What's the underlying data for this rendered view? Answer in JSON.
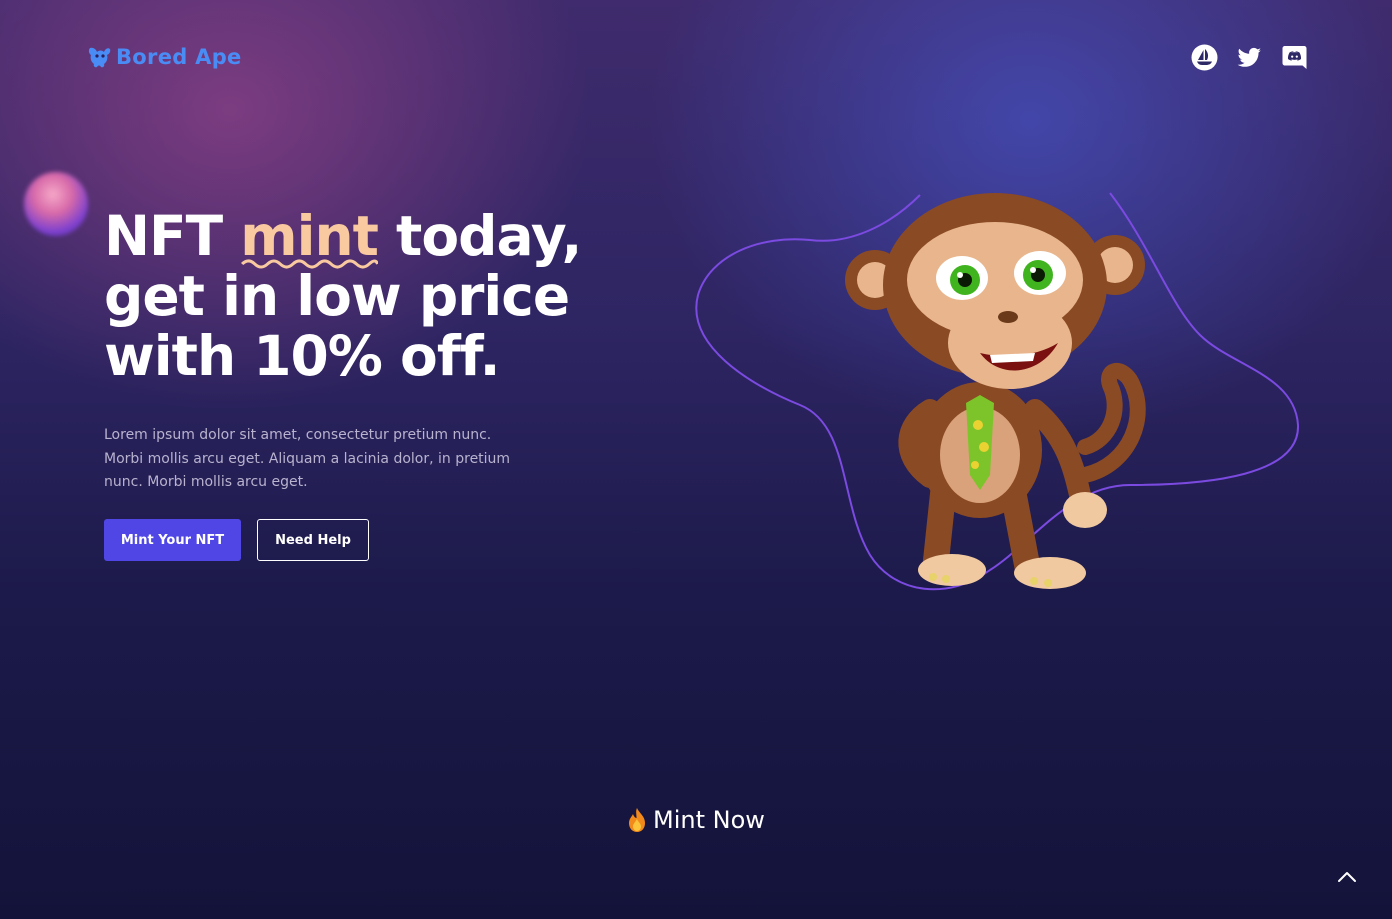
{
  "brand": {
    "name": "Bored Ape"
  },
  "social": [
    {
      "icon": "opensea-icon"
    },
    {
      "icon": "twitter-icon"
    },
    {
      "icon": "discord-icon"
    }
  ],
  "hero": {
    "title_part1": "NFT ",
    "title_highlight": "mint",
    "title_part2": " today,",
    "title_line2": "get in low price",
    "title_line3": "with 10% off.",
    "description": "Lorem ipsum dolor sit amet, consectetur pretium nunc. Morbi mollis arcu eget. Aliquam a lacinia dolor, in pretium nunc. Morbi mollis arcu eget.",
    "primary_button": "Mint Your NFT",
    "secondary_button": "Need Help"
  },
  "mint_now": {
    "label": "Mint Now",
    "icon": "fire-icon"
  },
  "scroll_top": {
    "icon": "chevron-up-icon"
  },
  "colors": {
    "accent": "#4f46e5",
    "logo": "#4a8cf5",
    "highlight": "#f9c9a0",
    "outline_path": "#7b4ae0"
  }
}
